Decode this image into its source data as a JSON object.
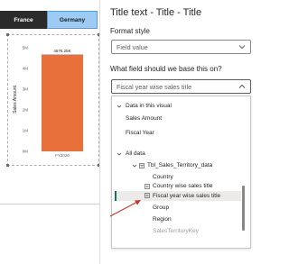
{
  "left": {
    "top_faint": "",
    "slicer": [
      {
        "label": "France",
        "state": "dark"
      },
      {
        "label": "Germany",
        "state": "selected"
      }
    ]
  },
  "chart_data": {
    "type": "bar",
    "categories": [
      "FY2020"
    ],
    "values": [
      4.676
    ],
    "data_labels": [
      "4676.25K"
    ],
    "title": "",
    "xlabel": "",
    "ylabel": "Sales Amount",
    "yticks": [
      "0M",
      "1M",
      "2M",
      "3M",
      "4M",
      "5M"
    ],
    "ylim": [
      0,
      5
    ],
    "bar_color": "#e8703a",
    "grid": false
  },
  "pane": {
    "title": "Title text - Title - Title",
    "format_style_label": "Format style",
    "format_style_value": "Field value",
    "base_label": "What field should we base this on?",
    "base_value": "Fiscal year wise sales title"
  },
  "dropdown": {
    "data_in_visual": "Data in this visual",
    "visual_fields": [
      "Sales Amount",
      "Fiscal Year"
    ],
    "all_data": "All data",
    "table_name": "Tbl_Sales_Territory_data",
    "fields": [
      "Country",
      "Country wise sales title",
      "Fiscal year wise sales title",
      "Group",
      "Region",
      "SalesTerritoryKey"
    ],
    "selected": "Fiscal year wise sales title"
  },
  "colors": {
    "accent": "#117865",
    "arrow": "#c0392b",
    "selected_slicer": "#9ecbf4"
  }
}
